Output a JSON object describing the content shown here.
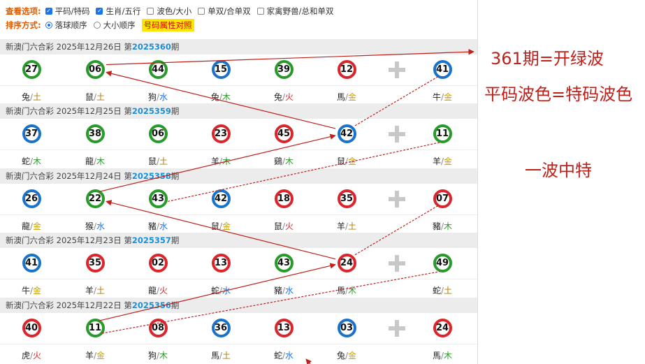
{
  "options": {
    "view_label": "查看选项:",
    "view_items": [
      {
        "label": "平码/特码",
        "checked": true
      },
      {
        "label": "生肖/五行",
        "checked": true
      },
      {
        "label": "波色/大小",
        "checked": false
      },
      {
        "label": "单双/合单双",
        "checked": false
      },
      {
        "label": "家禽野兽/总和单双",
        "checked": false
      }
    ],
    "sort_label": "排序方式:",
    "sort_items": [
      {
        "label": "落球顺序",
        "checked": true
      },
      {
        "label": "大小顺序",
        "checked": false
      }
    ],
    "highlight_button": "号码属性对照"
  },
  "draws": [
    {
      "prefix": "新澳门六合彩 2025年12月26日 第",
      "issue": "2025360",
      "suffix": "期",
      "balls": [
        {
          "num": "27",
          "color": "green",
          "zodiac": "兔",
          "element": "土",
          "el": "earth"
        },
        {
          "num": "06",
          "color": "green",
          "zodiac": "鼠",
          "element": "土",
          "el": "earth"
        },
        {
          "num": "44",
          "color": "green",
          "zodiac": "狗",
          "element": "水",
          "el": "water"
        },
        {
          "num": "15",
          "color": "blue",
          "zodiac": "兔",
          "element": "木",
          "el": "wood"
        },
        {
          "num": "39",
          "color": "green",
          "zodiac": "兔",
          "element": "火",
          "el": "fire"
        },
        {
          "num": "12",
          "color": "red",
          "zodiac": "馬",
          "element": "金",
          "el": "gold"
        },
        {
          "num": "41",
          "color": "blue",
          "zodiac": "牛",
          "element": "金",
          "el": "gold"
        }
      ]
    },
    {
      "prefix": "新澳门六合彩 2025年12月25日 第",
      "issue": "2025359",
      "suffix": "期",
      "balls": [
        {
          "num": "37",
          "color": "blue",
          "zodiac": "蛇",
          "element": "木",
          "el": "wood"
        },
        {
          "num": "38",
          "color": "green",
          "zodiac": "龍",
          "element": "木",
          "el": "wood"
        },
        {
          "num": "06",
          "color": "green",
          "zodiac": "鼠",
          "element": "土",
          "el": "earth"
        },
        {
          "num": "23",
          "color": "red",
          "zodiac": "羊",
          "element": "木",
          "el": "wood"
        },
        {
          "num": "45",
          "color": "red",
          "zodiac": "鷄",
          "element": "木",
          "el": "wood"
        },
        {
          "num": "42",
          "color": "blue",
          "zodiac": "鼠",
          "element": "金",
          "el": "gold"
        },
        {
          "num": "11",
          "color": "green",
          "zodiac": "羊",
          "element": "金",
          "el": "gold"
        }
      ]
    },
    {
      "prefix": "新澳门六合彩 2025年12月24日 第",
      "issue": "2025358",
      "suffix": "期",
      "balls": [
        {
          "num": "26",
          "color": "blue",
          "zodiac": "龍",
          "element": "金",
          "el": "gold"
        },
        {
          "num": "22",
          "color": "green",
          "zodiac": "猴",
          "element": "水",
          "el": "water"
        },
        {
          "num": "43",
          "color": "green",
          "zodiac": "豬",
          "element": "水",
          "el": "water"
        },
        {
          "num": "42",
          "color": "blue",
          "zodiac": "鼠",
          "element": "金",
          "el": "gold"
        },
        {
          "num": "18",
          "color": "red",
          "zodiac": "鼠",
          "element": "火",
          "el": "fire"
        },
        {
          "num": "35",
          "color": "red",
          "zodiac": "羊",
          "element": "土",
          "el": "earth"
        },
        {
          "num": "07",
          "color": "red",
          "zodiac": "豬",
          "element": "木",
          "el": "wood"
        }
      ]
    },
    {
      "prefix": "新澳门六合彩 2025年12月23日 第",
      "issue": "2025357",
      "suffix": "期",
      "balls": [
        {
          "num": "41",
          "color": "blue",
          "zodiac": "牛",
          "element": "金",
          "el": "gold"
        },
        {
          "num": "35",
          "color": "red",
          "zodiac": "羊",
          "element": "土",
          "el": "earth"
        },
        {
          "num": "02",
          "color": "red",
          "zodiac": "龍",
          "element": "火",
          "el": "fire"
        },
        {
          "num": "13",
          "color": "red",
          "zodiac": "蛇",
          "element": "水",
          "el": "water"
        },
        {
          "num": "43",
          "color": "green",
          "zodiac": "豬",
          "element": "水",
          "el": "water"
        },
        {
          "num": "24",
          "color": "red",
          "zodiac": "馬",
          "element": "木",
          "el": "wood"
        },
        {
          "num": "49",
          "color": "green",
          "zodiac": "蛇",
          "element": "土",
          "el": "earth"
        }
      ]
    },
    {
      "prefix": "新澳门六合彩 2025年12月22日 第",
      "issue": "2025356",
      "suffix": "期",
      "balls": [
        {
          "num": "40",
          "color": "red",
          "zodiac": "虎",
          "element": "火",
          "el": "fire"
        },
        {
          "num": "11",
          "color": "green",
          "zodiac": "羊",
          "element": "金",
          "el": "gold"
        },
        {
          "num": "08",
          "color": "red",
          "zodiac": "狗",
          "element": "木",
          "el": "wood"
        },
        {
          "num": "36",
          "color": "blue",
          "zodiac": "馬",
          "element": "土",
          "el": "earth"
        },
        {
          "num": "13",
          "color": "red",
          "zodiac": "蛇",
          "element": "水",
          "el": "water"
        },
        {
          "num": "03",
          "color": "blue",
          "zodiac": "兔",
          "element": "金",
          "el": "gold"
        },
        {
          "num": "24",
          "color": "red",
          "zodiac": "馬",
          "element": "木",
          "el": "wood"
        }
      ]
    }
  ],
  "annotations": {
    "note1": "361期=开绿波",
    "note2": "平码波色=特码波色",
    "note3": "一波中特"
  },
  "colors": {
    "accent_red": "#c0201a",
    "issue_blue": "#1a8fd6",
    "ball_red": "#d9252b",
    "ball_blue": "#1a73c9",
    "ball_green": "#279a2a"
  }
}
